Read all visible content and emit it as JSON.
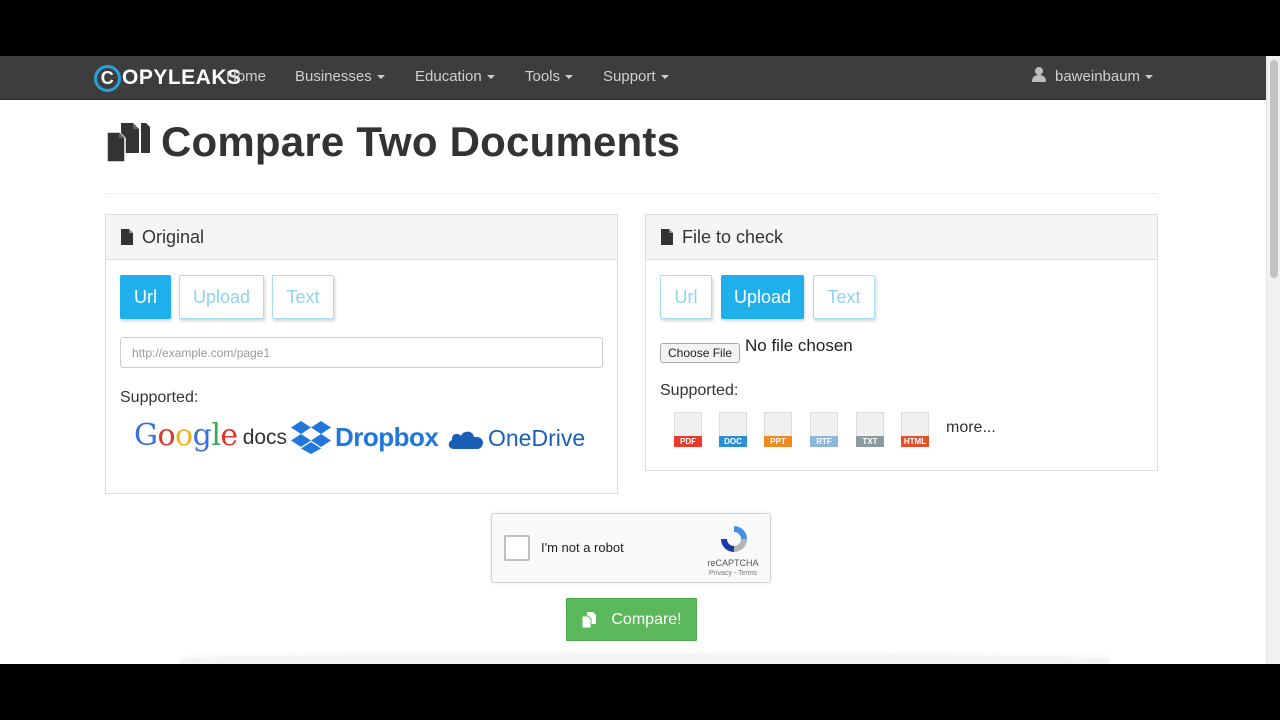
{
  "navbar": {
    "logo_letter": "C",
    "logo_rest": "OPYLEAKS",
    "items": [
      {
        "label": "Home"
      },
      {
        "label": "Businesses"
      },
      {
        "label": "Education"
      },
      {
        "label": "Tools"
      },
      {
        "label": "Support"
      }
    ],
    "user": "baweinbaum"
  },
  "page": {
    "title": "Compare Two Documents"
  },
  "original_panel": {
    "heading": "Original",
    "tabs": [
      "Url",
      "Upload",
      "Text"
    ],
    "active_tab": "Url",
    "url_placeholder": "http://example.com/page1",
    "supported_label": "Supported:",
    "brands": {
      "google_docs": "docs",
      "dropbox": "Dropbox",
      "onedrive": "OneDrive"
    }
  },
  "check_panel": {
    "heading": "File to check",
    "tabs": [
      "Url",
      "Upload",
      "Text"
    ],
    "active_tab": "Upload",
    "choose_file_label": "Choose File",
    "no_file_text": "No file chosen",
    "supported_label": "Supported:",
    "file_types": [
      {
        "label": "PDF",
        "color": "#e8392b"
      },
      {
        "label": "DOC",
        "color": "#2b8fd8"
      },
      {
        "label": "PPT",
        "color": "#f08a24"
      },
      {
        "label": "RTF",
        "color": "#8db7d9"
      },
      {
        "label": "TXT",
        "color": "#8a9a9e"
      },
      {
        "label": "HTML",
        "color": "#e4502c"
      }
    ],
    "more_label": "more..."
  },
  "recaptcha": {
    "label": "I'm not a robot",
    "brand": "reCAPTCHA",
    "terms": "Privacy - Terms"
  },
  "compare_button": {
    "label": "Compare!"
  },
  "colors": {
    "navbar_bg": "#3d3d3d",
    "accent_blue": "#1fb0ec",
    "compare_green": "#5cb85c"
  }
}
